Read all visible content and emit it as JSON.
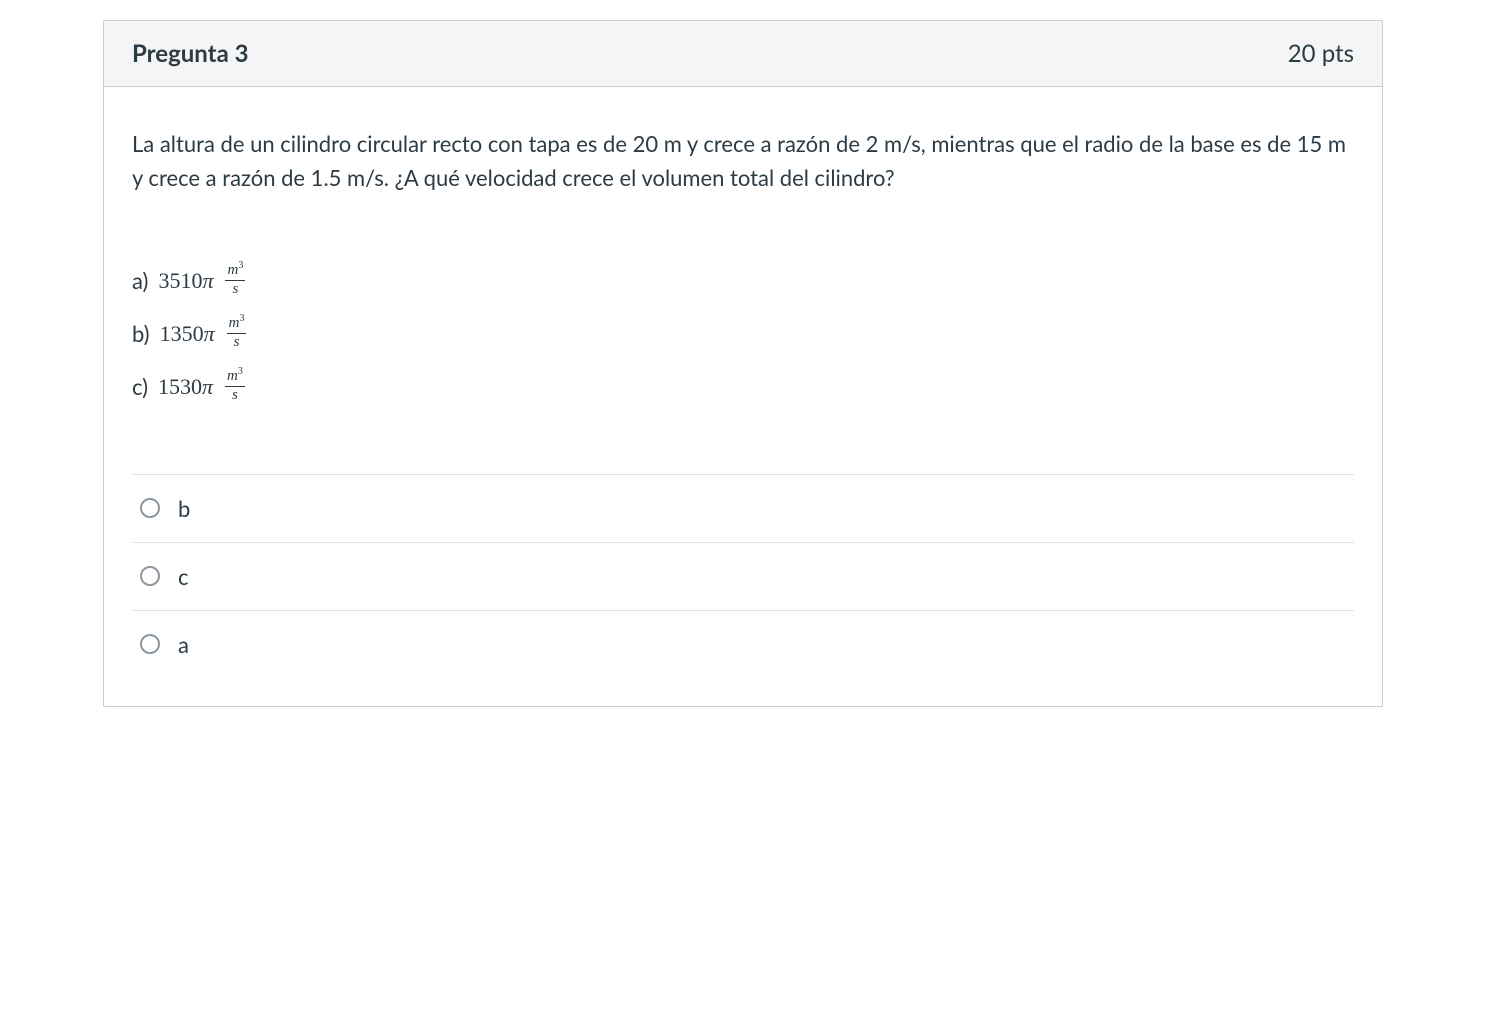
{
  "header": {
    "title": "Pregunta 3",
    "points": "20 pts"
  },
  "question": {
    "text": "La altura de un cilindro circular recto con tapa es de 20 m y crece a razón de 2 m/s, mientras que el radio de la base es de 15 m y crece a razón de 1.5 m/s. ¿A qué velocidad crece el volumen total del cilindro?"
  },
  "answers": {
    "a": {
      "letter": "a)",
      "value": "3510",
      "pi": "π",
      "unit_num": "m",
      "unit_exp": "3",
      "unit_den": "s"
    },
    "b": {
      "letter": "b)",
      "value": "1350",
      "pi": "π",
      "unit_num": "m",
      "unit_exp": "3",
      "unit_den": "s"
    },
    "c": {
      "letter": "c)",
      "value": "1530",
      "pi": "π",
      "unit_num": "m",
      "unit_exp": "3",
      "unit_den": "s"
    }
  },
  "options": [
    {
      "label": "b"
    },
    {
      "label": "c"
    },
    {
      "label": "a"
    }
  ]
}
